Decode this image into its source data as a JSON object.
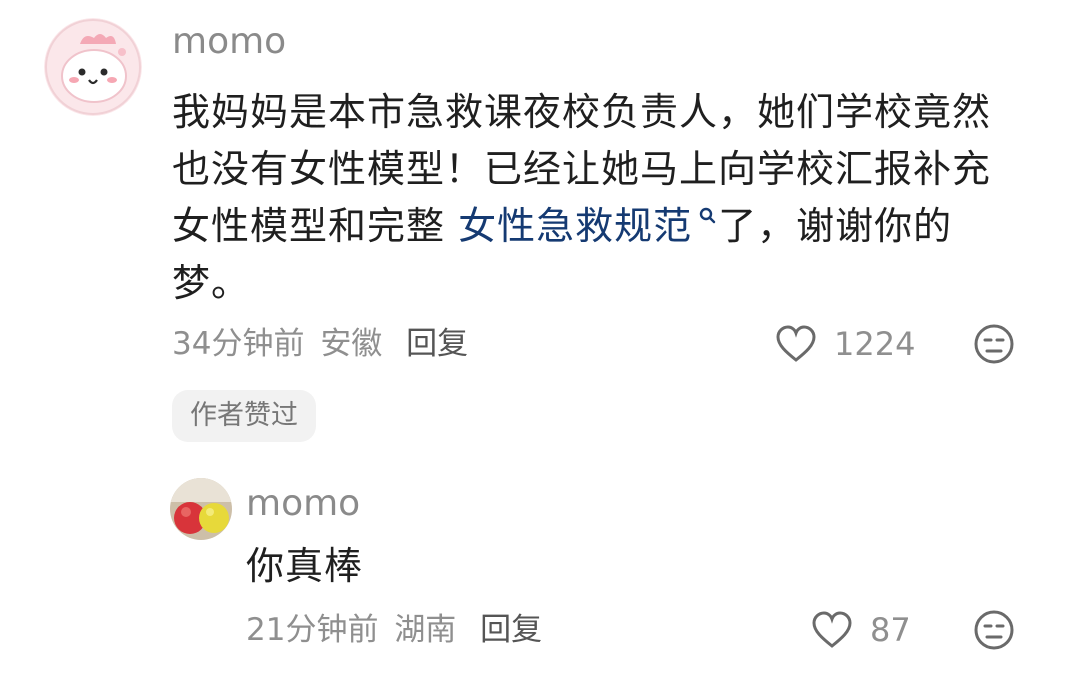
{
  "comment": {
    "username": "momo",
    "text_before_link": "我妈妈是本市急救课夜校负责人，她们学校竟然也没有女性模型！已经让她马上向学校汇报补充女性模型和完整",
    "link_text": "女性急救规范",
    "text_after_link": "了，谢谢你的梦。",
    "time": "34分钟前",
    "location": "安徽",
    "reply_label": "回复",
    "likes": "1224",
    "author_liked_badge": "作者赞过",
    "icons": {
      "like": "heart-outline-icon",
      "dislike": "neutral-face-icon",
      "link_search": "search-icon"
    }
  },
  "reply": {
    "username": "momo",
    "text": "你真棒",
    "time": "21分钟前",
    "location": "湖南",
    "reply_label": "回复",
    "likes": "87",
    "icons": {
      "like": "heart-outline-icon",
      "dislike": "neutral-face-icon"
    }
  }
}
